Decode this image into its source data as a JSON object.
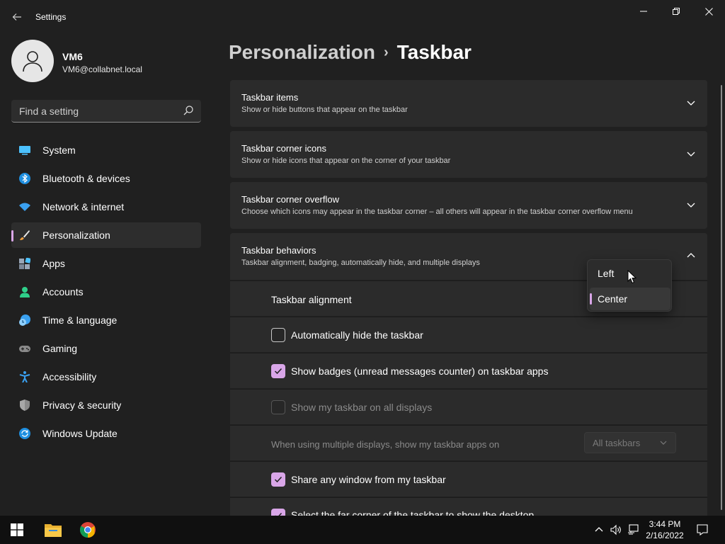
{
  "window": {
    "title": "Settings",
    "back_glyph": "←",
    "minimize_glyph": "─",
    "maximize_glyph": "❐",
    "close_glyph": "✕"
  },
  "user": {
    "name": "VM6",
    "email": "VM6@collabnet.local"
  },
  "search": {
    "placeholder": "Find a setting",
    "icon": "search-icon"
  },
  "nav": {
    "items": [
      {
        "label": "System",
        "icon": "system-icon"
      },
      {
        "label": "Bluetooth & devices",
        "icon": "bluetooth-icon"
      },
      {
        "label": "Network & internet",
        "icon": "network-icon"
      },
      {
        "label": "Personalization",
        "icon": "brush-icon",
        "selected": true
      },
      {
        "label": "Apps",
        "icon": "apps-icon"
      },
      {
        "label": "Accounts",
        "icon": "accounts-icon"
      },
      {
        "label": "Time & language",
        "icon": "time-language-icon"
      },
      {
        "label": "Gaming",
        "icon": "gaming-icon"
      },
      {
        "label": "Accessibility",
        "icon": "accessibility-icon"
      },
      {
        "label": "Privacy & security",
        "icon": "shield-icon"
      },
      {
        "label": "Windows Update",
        "icon": "update-icon"
      }
    ]
  },
  "breadcrumb": {
    "parent": "Personalization",
    "separator": "›",
    "current": "Taskbar"
  },
  "sections": [
    {
      "title": "Taskbar items",
      "subtitle": "Show or hide buttons that appear on the taskbar",
      "expanded": false
    },
    {
      "title": "Taskbar corner icons",
      "subtitle": "Show or hide icons that appear on the corner of your taskbar",
      "expanded": false
    },
    {
      "title": "Taskbar corner overflow",
      "subtitle": "Choose which icons may appear in the taskbar corner – all others will appear in the taskbar corner overflow menu",
      "expanded": false
    },
    {
      "title": "Taskbar behaviors",
      "subtitle": "Taskbar alignment, badging, automatically hide, and multiple displays",
      "expanded": true
    }
  ],
  "behaviors": {
    "alignment_label": "Taskbar alignment",
    "alignment_options": [
      "Left",
      "Center"
    ],
    "alignment_selected": "Center",
    "auto_hide": {
      "label": "Automatically hide the taskbar",
      "checked": false
    },
    "show_badges": {
      "label": "Show badges (unread messages counter) on taskbar apps",
      "checked": true
    },
    "all_displays": {
      "label": "Show my taskbar on all displays",
      "checked": false,
      "disabled": true
    },
    "multi_display_label": "When using multiple displays, show my taskbar apps on",
    "multi_display_value": "All taskbars",
    "share_window": {
      "label": "Share any window from my taskbar",
      "checked": true
    },
    "far_corner": {
      "label": "Select the far corner of the taskbar to show the desktop",
      "checked": true
    }
  },
  "taskbar": {
    "apps": [
      "windows-start-icon",
      "file-explorer-icon",
      "chrome-icon"
    ],
    "time": "3:44 PM",
    "date": "2/16/2022"
  },
  "colors": {
    "accent": "#d9a6e8",
    "background": "#202020",
    "card": "#2b2b2b"
  }
}
